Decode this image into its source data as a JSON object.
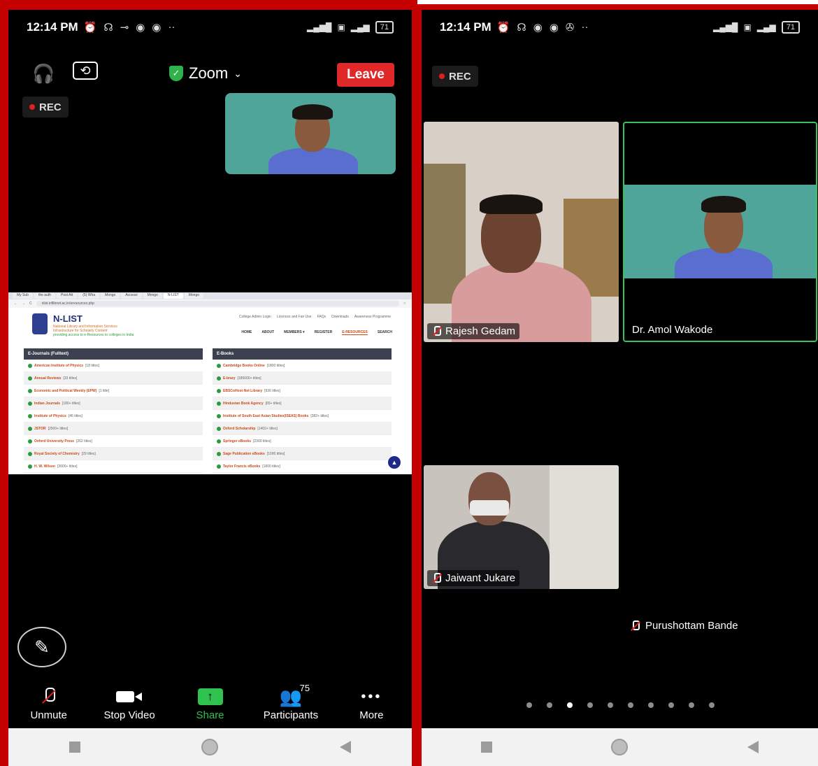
{
  "status": {
    "time": "12:14 PM",
    "battery": "71"
  },
  "left": {
    "rec_label": "REC",
    "meeting_title": "Zoom",
    "leave_label": "Leave",
    "shared": {
      "tabs": [
        "My Sub",
        "the auth",
        "Post Att",
        "(5) Wha",
        "Mongo",
        "Accessi",
        "Mongo",
        "N-LIST",
        "Mongo"
      ],
      "url": "nlist.inflibnet.ac.in/eresources.php",
      "site_title": "N-LIST",
      "site_sub1": "National Library and Information Services",
      "site_sub2": "Infrastructure for Scholarly Content",
      "site_sub3": "providing access to e-Resources to colleges in India",
      "top_links": [
        "College Admin Login",
        "Licences and Fair Use",
        "FAQs",
        "Downloads",
        "Awareness Programme"
      ],
      "menu": [
        "HOME",
        "ABOUT",
        "MEMBERS ▾",
        "REGISTER",
        "E-RESOURCES",
        "SEARCH"
      ],
      "journals_header": "E-Journals (Fulltext)",
      "books_header": "E-Books",
      "journals": [
        {
          "name": "American Institute of Physics",
          "count": "[18 titles]"
        },
        {
          "name": "Annual Reviews",
          "count": "[33 titles]"
        },
        {
          "name": "Economic and Political Weekly (EPW)",
          "count": "[1 title]"
        },
        {
          "name": "Indian Journals",
          "count": "[180+ titles]"
        },
        {
          "name": "Institute of Physics",
          "count": "[46 titles]"
        },
        {
          "name": "JSTOR",
          "count": "[2500+ titles]"
        },
        {
          "name": "Oxford University Press",
          "count": "[262 titles]"
        },
        {
          "name": "Royal Society of Chemistry",
          "count": "[29 titles]"
        },
        {
          "name": "H. W. Wilson",
          "count": "[3000+ titles]"
        }
      ],
      "books": [
        {
          "name": "Cambridge Books Online",
          "count": "[1800 titles]"
        },
        {
          "name": "E-brary",
          "count": "[185000+ titles]"
        },
        {
          "name": "EBSCoHost-Net Library",
          "count": "[936 titles]"
        },
        {
          "name": "Hindustan Book Agency",
          "count": "[65+ titles]"
        },
        {
          "name": "Institute of South East Asian Studies(ISEAS) Books",
          "count": "[382+ titles]"
        },
        {
          "name": "Oxford Scholarship",
          "count": "[1402+ titles]"
        },
        {
          "name": "Springer eBooks",
          "count": "[2300 titles]"
        },
        {
          "name": "Sage Publication eBooks",
          "count": "[1000 titles]"
        },
        {
          "name": "Taylor Francis eBooks",
          "count": "[1800 titles]"
        }
      ]
    },
    "toolbar": {
      "unmute": "Unmute",
      "stop_video": "Stop Video",
      "share": "Share",
      "participants": "Participants",
      "participants_count": "75",
      "more": "More"
    }
  },
  "right": {
    "rec_label": "REC",
    "participants": [
      "Rajesh Gedam",
      "Dr. Amol Wakode",
      "Jaiwant Jukare",
      "Purushottam Bande"
    ],
    "page_dots": 10,
    "active_page": 3
  },
  "colors": {
    "accent_green": "#2fc24f",
    "leave_red": "#e02828",
    "frame_red": "#c40000"
  }
}
